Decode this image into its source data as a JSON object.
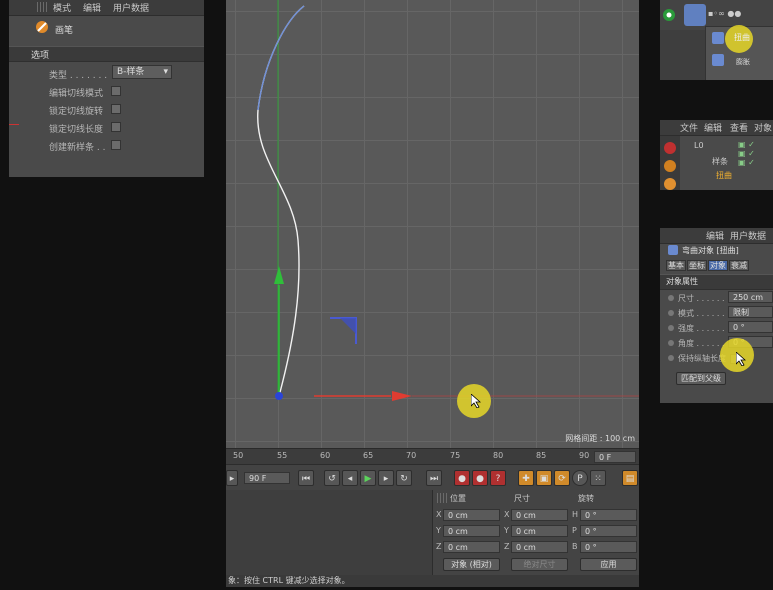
{
  "left_panel": {
    "menu": [
      "模式",
      "编辑",
      "用户数据"
    ],
    "title": "画笔",
    "section": "选项",
    "type_label": "类型 . . . . . . .",
    "type_value": "B-样条",
    "options": [
      "编辑切线模式",
      "锁定切线旋转",
      "锁定切线长度",
      "创建新样条 . ."
    ]
  },
  "viewport": {
    "grid_spacing": "网格间距 : 100 cm"
  },
  "timeline": {
    "ticks": [
      "50",
      "55",
      "60",
      "65",
      "70",
      "75",
      "80",
      "85",
      "90"
    ],
    "current_frame": "0 F",
    "end_frame": "90 F"
  },
  "coordinates": {
    "headers": [
      "位置",
      "尺寸",
      "旋转"
    ],
    "rows": [
      {
        "axis1": "X",
        "pos": "0 cm",
        "axis2": "X",
        "size": "0 cm",
        "axis3": "H",
        "rot": "0 °"
      },
      {
        "axis1": "Y",
        "pos": "0 cm",
        "axis2": "Y",
        "size": "0 cm",
        "axis3": "P",
        "rot": "0 °"
      },
      {
        "axis1": "Z",
        "pos": "0 cm",
        "axis2": "Z",
        "size": "0 cm",
        "axis3": "B",
        "rot": "0 °"
      }
    ],
    "mode_dropdown": "对象 (相对)",
    "size_dropdown": "绝对尺寸",
    "apply_button": "应用"
  },
  "status": {
    "text": "象：按住 CTRL 键减少选择对象。"
  },
  "top_right": {
    "menu_label": "扭曲",
    "sub_label": "膨胀"
  },
  "object_manager": {
    "menu": [
      "文件",
      "编辑",
      "查看",
      "对象"
    ],
    "items": [
      "L0",
      "样条",
      "扭曲"
    ]
  },
  "attributes": {
    "menu": [
      "编辑",
      "用户数据"
    ],
    "title": "弯曲对象 [扭曲]",
    "tabs": [
      "基本",
      "坐标",
      "对象",
      "衰减"
    ],
    "section": "对象属性",
    "rows": [
      {
        "label": "尺寸 . . . . . .",
        "value": "250 cm"
      },
      {
        "label": "模式 . . . . . .",
        "value": "限制"
      },
      {
        "label": "强度 . . . . . .",
        "value": "0 °"
      },
      {
        "label": "角度 . . . . . .",
        "value": "0 °"
      },
      {
        "label": "保持纵轴长度",
        "value": ""
      }
    ],
    "button": "匹配到父级"
  },
  "colors": {
    "x_axis": "#e03c31",
    "y_axis": "#2fbf3a",
    "spline": "#f2f2f2",
    "cursor_highlight": "#e6d728"
  }
}
